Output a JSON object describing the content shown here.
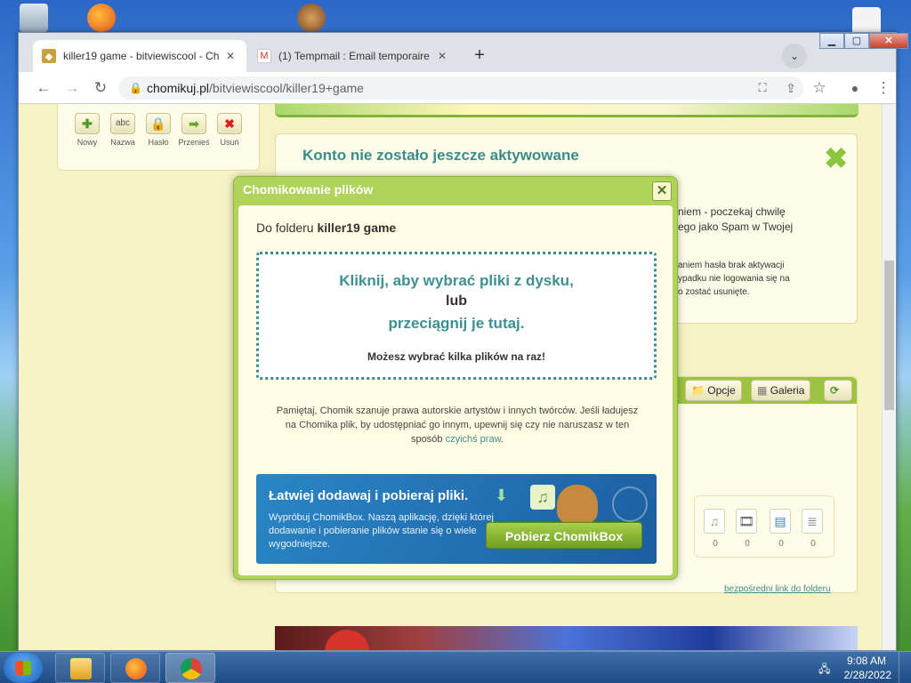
{
  "browser": {
    "tabs": [
      {
        "title": "killer19 game - bitviewiscool - Ch",
        "active": true
      },
      {
        "title": "(1) Tempmail : Email temporaire",
        "active": false
      }
    ],
    "url_domain": "chomikuj.pl",
    "url_path": "/bitviewiscool/killer19+game"
  },
  "left_toolbar": {
    "items": [
      {
        "label": "Nowy",
        "icon": "plus-icon"
      },
      {
        "label": "Nazwa",
        "icon": "abc-icon"
      },
      {
        "label": "Hasło",
        "icon": "lock-icon"
      },
      {
        "label": "Przenieś",
        "icon": "arrow-right-icon"
      },
      {
        "label": "Usuń",
        "icon": "delete-icon"
      }
    ]
  },
  "notice": {
    "title": "Konto nie zostało jeszcze aktywowane",
    "line1": "niem - poczekaj chwilę",
    "line2": "ego jako Spam w Twojej",
    "line3": "aniem hasła brak aktywacji",
    "line4": "ypadku nie logowania się na",
    "line5": "o zostać usunięte."
  },
  "filebox": {
    "options_label": "Opcje",
    "gallery_label": "Galeria",
    "counts": [
      "0",
      "0",
      "0",
      "0"
    ],
    "direct_link": "bezpośredni link do folderu"
  },
  "modal": {
    "title": "Chomikowanie plików",
    "close_label": "✕",
    "folder_prefix": "Do folderu",
    "folder_name": "killer19 game",
    "drop_line1": "Kliknij, aby wybrać pliki z dysku,",
    "drop_line2": "lub",
    "drop_line3": "przeciągnij je tutaj.",
    "drop_hint": "Możesz wybrać kilka plików na raz!",
    "legal_text": "Pamiętaj, Chomik szanuje prawa autorskie artystów i innych twórców. Jeśli ładujesz na Chomika plik, by udostępniać go innym, upewnij się czy nie naruszasz w ten sposób",
    "legal_link": "czyichś praw",
    "chomikbox_title": "Łatwiej dodawaj i pobieraj pliki.",
    "chomikbox_desc": "Wypróbuj ChomikBox. Naszą aplikację, dzięki której dodawanie i pobieranie plików stanie się o wiele wygodniejsze.",
    "chomikbox_button": "Pobierz ChomikBox"
  },
  "taskbar": {
    "time": "9:08 AM",
    "date": "2/28/2022"
  }
}
